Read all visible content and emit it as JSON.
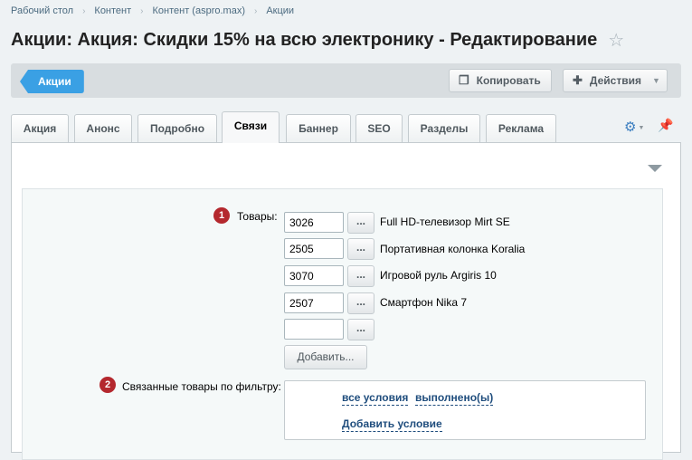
{
  "breadcrumb": [
    "Рабочий стол",
    "Контент",
    "Контент (aspro.max)",
    "Акции"
  ],
  "page_title": "Акции: Акция: Скидки 15% на всю электронику - Редактирование",
  "toolbar": {
    "back_label": "Акции",
    "copy_label": "Копировать",
    "actions_label": "Действия"
  },
  "tabs": [
    "Акция",
    "Анонс",
    "Подробно",
    "Связи",
    "Баннер",
    "SEO",
    "Разделы",
    "Реклама"
  ],
  "active_tab": "Связи",
  "form": {
    "products": {
      "badge": "1",
      "label": "Товары:",
      "items": [
        {
          "id": "3026",
          "name": "Full HD-телевизор Mirt SE"
        },
        {
          "id": "2505",
          "name": "Портативная колонка Koralia"
        },
        {
          "id": "3070",
          "name": "Игровой руль Argiris 10"
        },
        {
          "id": "2507",
          "name": "Смартфон Nika 7"
        },
        {
          "id": "",
          "name": ""
        }
      ],
      "browse_label": "...",
      "add_label": "Добавить..."
    },
    "filter": {
      "badge": "2",
      "label": "Связанные товары по фильтру:",
      "all_conditions": "все условия",
      "fulfilled": "выполнено(ы)",
      "add_condition": "Добавить условие"
    }
  },
  "colors": {
    "accent": "#3aa0e4",
    "badge": "#b4282e",
    "link": "#1f4d7d"
  }
}
